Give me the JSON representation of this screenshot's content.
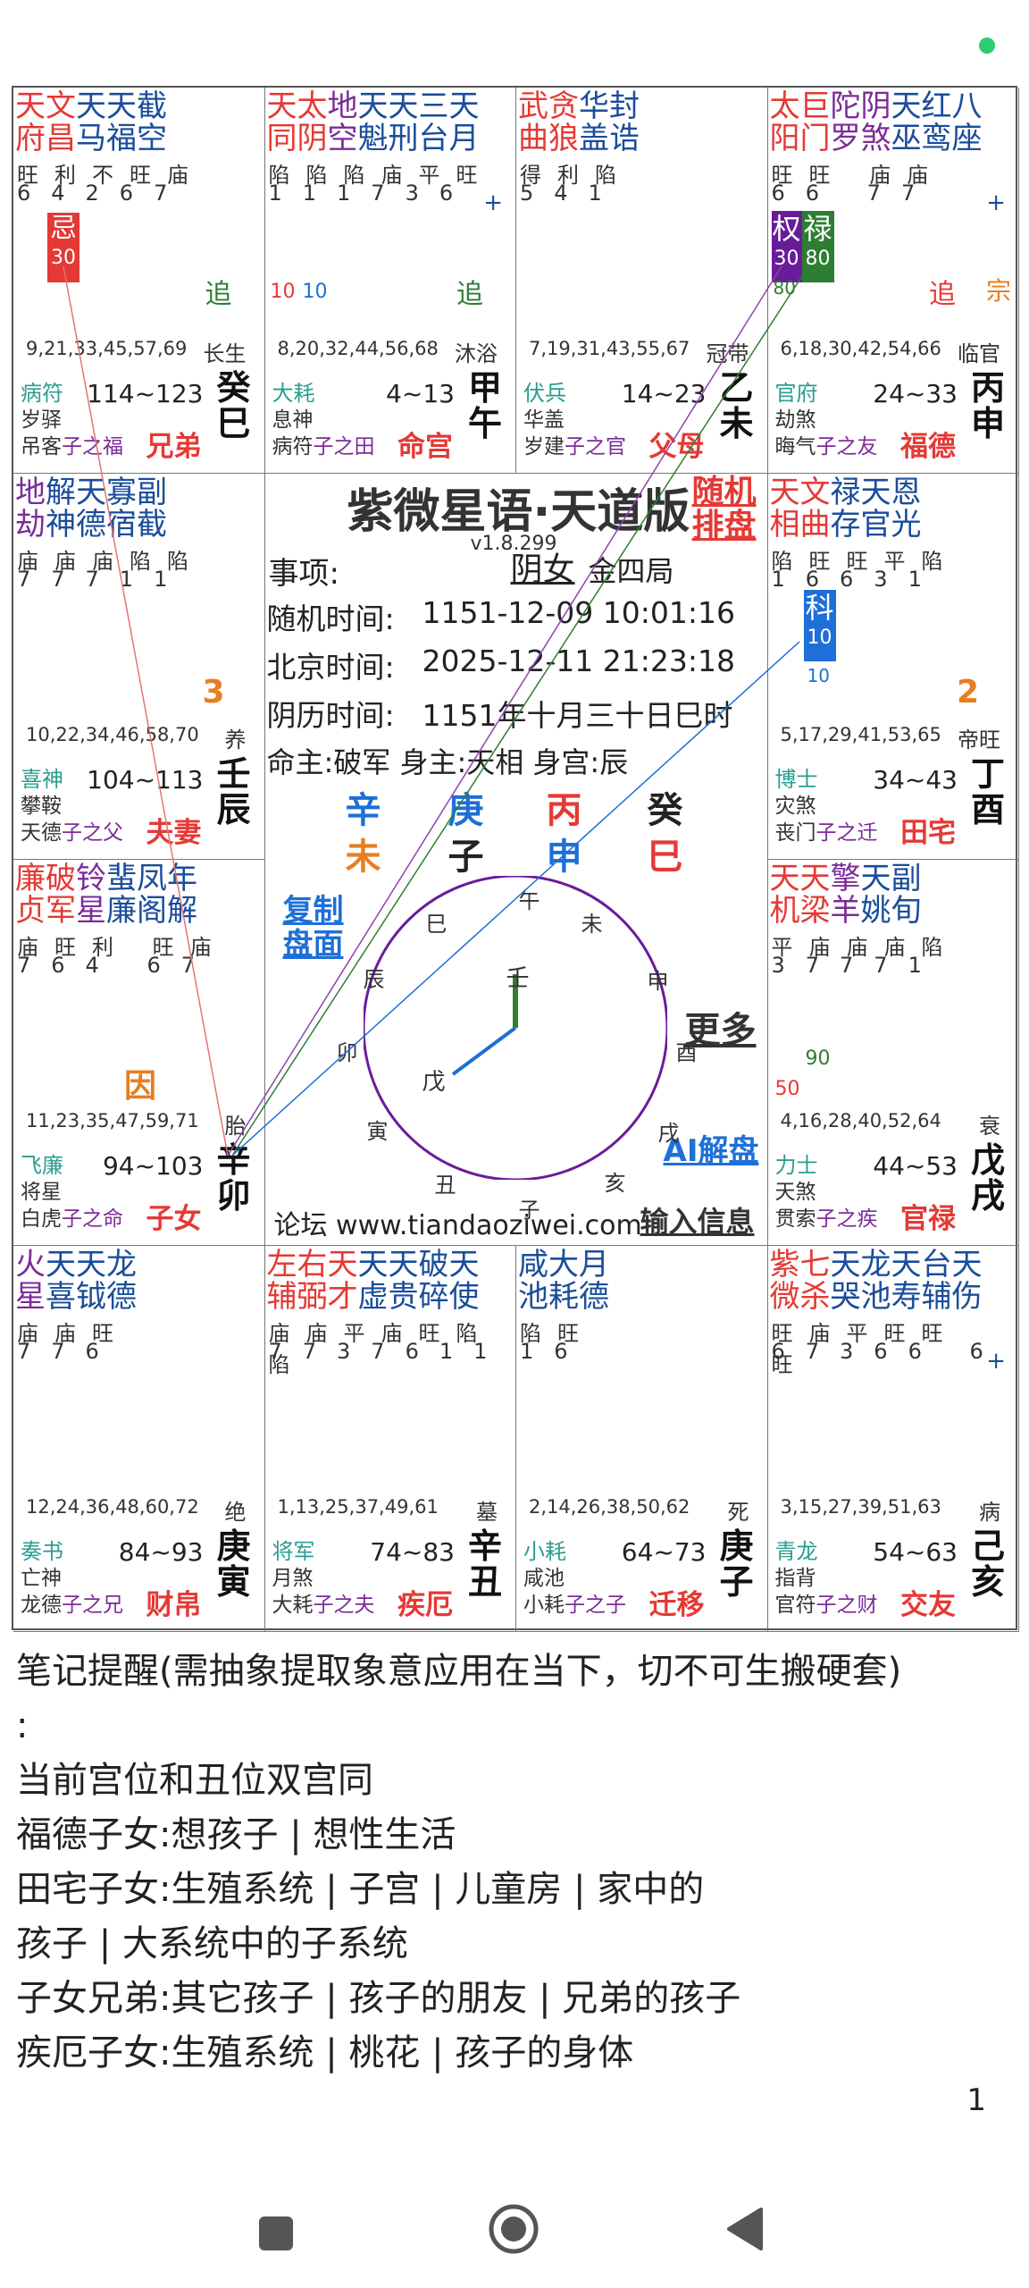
{
  "app_title": "紫微星语·天道版",
  "version": "v1.8.299",
  "random_btn": "随机排盘",
  "event_label": "事项:",
  "gender_label": "阴女",
  "ju_label": "金四局",
  "random_time_label": "随机时间:",
  "random_time": "1151-12-09 10:01:16",
  "beijing_time_label": "北京时间:",
  "beijing_time": "2025-12-11 21:23:18",
  "lunar_time_label": "阴历时间:",
  "lunar_time": "1151年十月三十日巳时",
  "ming_zhu": "命主:破军 身主:天相 身宫:辰",
  "pillars_top": [
    "辛",
    "庚",
    "丙",
    "癸"
  ],
  "pillars_bottom": [
    "未",
    "子",
    "申",
    "巳"
  ],
  "copy_btn": "复制盘面",
  "more_btn": "更多",
  "ai_btn": "AI解盘",
  "forum": "论坛 www.tiandaoziwei.com",
  "input_btn": "输入信息",
  "clock_branches": [
    "午",
    "未",
    "申",
    "酉",
    "戌",
    "亥",
    "子",
    "丑",
    "寅",
    "卯",
    "辰",
    "巳"
  ],
  "clock_inner": [
    "壬",
    "戊"
  ],
  "palaces": {
    "si": {
      "stars": [
        [
          "天",
          "文",
          "天",
          "天",
          "截"
        ],
        [
          "府",
          "昌",
          "马",
          "福",
          "空"
        ]
      ],
      "brightness": "旺利不旺庙",
      "level": "64267",
      "ages": "9,21,33,45,57,69",
      "cs": "长生",
      "g1": "病符",
      "g2": "岁驿",
      "g3a": "吊客",
      "g3b": "子之福",
      "range": "114~123",
      "gz": [
        "癸",
        "巳"
      ],
      "name": "兄弟",
      "extra": "追",
      "ji": "忌",
      "ji_num": "30"
    },
    "wu": {
      "stars": [
        [
          "天",
          "太",
          "地",
          "天",
          "天",
          "三",
          "天"
        ],
        [
          "同",
          "阴",
          "空",
          "魁",
          "刑",
          "台",
          "月"
        ]
      ],
      "brightness": "陷陷陷庙平旺",
      "level": "111736",
      "ages": "8,20,32,44,56,68",
      "cs": "沐浴",
      "g1": "大耗",
      "g2": "息神",
      "g3a": "病符",
      "g3b": "子之田",
      "range": "4~13",
      "gz": [
        "甲",
        "午"
      ],
      "name": "命宫",
      "extra": "追",
      "n1": "10",
      "n2": "10"
    },
    "wei": {
      "stars": [
        [
          "武",
          "贪",
          "华",
          "封"
        ],
        [
          "曲",
          "狼",
          "盖",
          "诰"
        ]
      ],
      "brightness": "得利陷",
      "level": "541",
      "ages": "7,19,31,43,55,67",
      "cs": "冠带",
      "g1": "伏兵",
      "g2": "华盖",
      "g3a": "岁建",
      "g3b": "子之官",
      "range": "14~23",
      "gz": [
        "乙",
        "未"
      ],
      "name": "父母"
    },
    "shen": {
      "stars": [
        [
          "太",
          "巨",
          "陀",
          "阴",
          "天",
          "红",
          "八"
        ],
        [
          "阳",
          "门",
          "罗",
          "煞",
          "巫",
          "鸾",
          "座"
        ]
      ],
      "brightness": "旺旺     庙庙",
      "level": "66     77",
      "ages": "6,18,30,42,54,66",
      "cs": "临官",
      "g1": "官府",
      "g2": "劫煞",
      "g3a": "晦气",
      "g3b": "子之友",
      "range": "24~33",
      "gz": [
        "丙",
        "申"
      ],
      "name": "福德",
      "extra": "追",
      "extra2": "宗",
      "quan": "权",
      "quan_num": "30",
      "lu": "禄",
      "lu_num": "80",
      "under": "80"
    },
    "chen": {
      "stars": [
        [
          "地",
          "解",
          "天",
          "寡",
          "副"
        ],
        [
          "劫",
          "神",
          "德",
          "宿",
          "截"
        ]
      ],
      "brightness": "庙庙庙陷陷",
      "level": "77711",
      "ages": "10,22,34,46,58,70",
      "cs": "养",
      "g1": "喜神",
      "g2": "攀鞍",
      "g3a": "天德",
      "g3b": "子之父",
      "range": "104~113",
      "gz": [
        "壬",
        "辰"
      ],
      "name": "夫妻",
      "num": "3"
    },
    "you": {
      "stars": [
        [
          "天",
          "文",
          "禄",
          "天",
          "恩"
        ],
        [
          "相",
          "曲",
          "存",
          "官",
          "光"
        ]
      ],
      "brightness": "陷旺旺平陷",
      "level": "16631",
      "ages": "5,17,29,41,53,65",
      "cs": "帝旺",
      "g1": "博士",
      "g2": "灾煞",
      "g3a": "丧门",
      "g3b": "子之迁",
      "range": "34~43",
      "gz": [
        "丁",
        "酉"
      ],
      "name": "田宅",
      "num": "2",
      "ke": "科",
      "ke_num": "10",
      "under": "10"
    },
    "mao": {
      "stars": [
        [
          "廉",
          "破",
          "铃",
          "蜚",
          "凤",
          "年"
        ],
        [
          "贞",
          "军",
          "星",
          "廉",
          "阁",
          "解"
        ]
      ],
      "brightness": "庙旺利  旺庙",
      "level": "764  67",
      "ages": "11,23,35,47,59,71",
      "cs": "胎",
      "g1": "飞廉",
      "g2": "将星",
      "g3a": "白虎",
      "g3b": "子之命",
      "range": "94~103",
      "gz": [
        "辛",
        "卯"
      ],
      "name": "子女",
      "yin": "因"
    },
    "xu": {
      "stars": [
        [
          "天",
          "天",
          "擎",
          "天",
          "副"
        ],
        [
          "机",
          "梁",
          "羊",
          "姚",
          "旬"
        ]
      ],
      "brightness": "平庙庙庙陷",
      "level": "37771",
      "ages": "4,16,28,40,52,64",
      "cs": "衰",
      "g1": "力士",
      "g2": "天煞",
      "g3a": "贯索",
      "g3b": "子之疾",
      "range": "44~53",
      "gz": [
        "戊",
        "戌"
      ],
      "name": "官禄",
      "n1": "50",
      "n2": "90"
    },
    "yin": {
      "stars": [
        [
          "火",
          "天",
          "天",
          "龙"
        ],
        [
          "星",
          "喜",
          "钺",
          "德"
        ]
      ],
      "brightness": "庙庙旺",
      "level": "776",
      "ages": "12,24,36,48,60,72",
      "cs": "绝",
      "g1": "奏书",
      "g2": "亡神",
      "g3a": "龙德",
      "g3b": "子之兄",
      "range": "84~93",
      "gz": [
        "庚",
        "寅"
      ],
      "name": "财帛"
    },
    "chou": {
      "stars": [
        [
          "左",
          "右",
          "天",
          "天",
          "天",
          "破",
          "天"
        ],
        [
          "辅",
          "弼",
          "才",
          "虚",
          "贵",
          "碎",
          "使"
        ]
      ],
      "brightness": "庙庙平庙旺陷陷",
      "level": "7737611",
      "ages": "1,13,25,37,49,61",
      "cs": "墓",
      "g1": "将军",
      "g2": "月煞",
      "g3a": "大耗",
      "g3b": "子之夫",
      "range": "74~83",
      "gz": [
        "辛",
        "丑"
      ],
      "name": "疾厄"
    },
    "zi": {
      "stars": [
        [
          "咸",
          "大",
          "月"
        ],
        [
          "池",
          "耗",
          "德"
        ]
      ],
      "brightness": "陷旺",
      "level": "16",
      "ages": "2,14,26,38,50,62",
      "cs": "死",
      "g1": "小耗",
      "g2": "咸池",
      "g3a": "小耗",
      "g3b": "子之子",
      "range": "64~73",
      "gz": [
        "庚",
        "子"
      ],
      "name": "迁移"
    },
    "hai": {
      "stars": [
        [
          "紫",
          "七",
          "天",
          "龙",
          "天",
          "台",
          "天"
        ],
        [
          "微",
          "杀",
          "哭",
          "池",
          "寿",
          "辅",
          "伤"
        ]
      ],
      "brightness": "旺庙平旺旺  旺",
      "level": "67366  6",
      "ages": "3,15,27,39,51,63",
      "cs": "病",
      "g1": "青龙",
      "g2": "指背",
      "g3a": "官符",
      "g3b": "子之财",
      "range": "54~63",
      "gz": [
        "己",
        "亥"
      ],
      "name": "交友"
    }
  },
  "notes": [
    "笔记提醒(需抽象提取象意应用在当下，切不可生搬硬套)",
    ":",
    "当前宫位和丑位双宫同",
    "福德子女:想孩子 | 想性生活",
    "田宅子女:生殖系统 | 子宫 | 儿童房 | 家中的",
    "孩子 | 大系统中的子系统",
    "子女兄弟:其它孩子 | 孩子的朋友 | 兄弟的孩子",
    "疾厄子女:生殖系统 | 桃花 | 孩子的身体"
  ],
  "page_num": "1"
}
